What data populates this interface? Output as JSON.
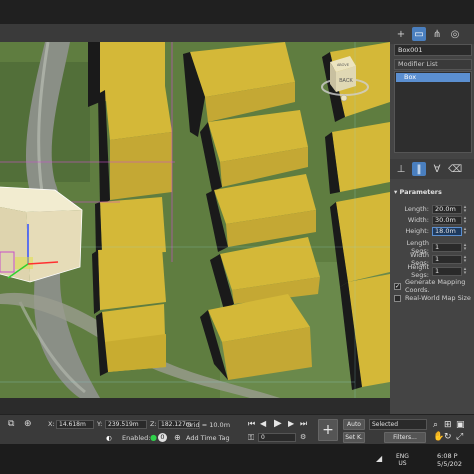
{
  "command_panel": {
    "object_name": "Box001",
    "modifier_list_label": "Modifier List",
    "modifier_stack": [
      "Box"
    ],
    "rollout_title": "Parameters",
    "params": [
      {
        "label": "Length:",
        "value": "20.0m"
      },
      {
        "label": "Width:",
        "value": "30.0m"
      },
      {
        "label": "Height:",
        "value": "18.0m"
      },
      {
        "label": "Length Segs:",
        "value": "1"
      },
      {
        "label": "Width Segs:",
        "value": "1"
      },
      {
        "label": "Height Segs:",
        "value": "1"
      }
    ],
    "generate_mapping": {
      "label": "Generate Mapping Coords.",
      "checked": true
    },
    "real_world_map": {
      "label": "Real-World Map Size",
      "checked": false
    }
  },
  "viewcube": {
    "label": "BACK",
    "top_label": "ABOVE"
  },
  "status_bar": {
    "x_label": "X:",
    "x_value": "14.618m",
    "y_label": "Y:",
    "y_value": "239.519m",
    "z_label": "Z:",
    "z_value": "182.127m",
    "grid": "Grid = 10.0m",
    "enabled_label": "Enabled:",
    "enabled_value": "0",
    "add_time_tag": "Add Time Tag",
    "auto_label": "Auto",
    "set_key_label": "Set K.",
    "selected_label": "Selected",
    "filters_label": "Filters...",
    "frame_value": "0"
  },
  "taskbar": {
    "lang_1": "ENG",
    "lang_2": "US",
    "time": "6:08 P",
    "date": "5/5/202"
  },
  "colors": {
    "building_top": "#d4b838",
    "building_side": "#b09428",
    "selected_box": "#ece4c0",
    "selection_brackets": "#d23ad2"
  }
}
